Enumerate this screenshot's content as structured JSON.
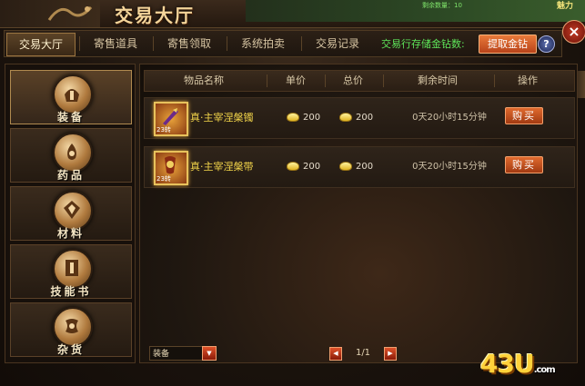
{
  "window": {
    "title": "交易大厅",
    "close_label": "×"
  },
  "game_overlay": {
    "line1": "剩余数量：10",
    "right_text": "魅力"
  },
  "tabs": [
    {
      "label": "交易大厅",
      "active": true
    },
    {
      "label": "寄售道具",
      "active": false
    },
    {
      "label": "寄售领取",
      "active": false
    },
    {
      "label": "系统拍卖",
      "active": false
    },
    {
      "label": "交易记录",
      "active": false
    }
  ],
  "storage": {
    "label": "交易行存储金钻数:",
    "withdraw_label": "提取金钻",
    "help_label": "?"
  },
  "categories": [
    {
      "label": "装备",
      "icon": "helmet-icon",
      "active": true
    },
    {
      "label": "药品",
      "icon": "potion-icon",
      "active": false
    },
    {
      "label": "材料",
      "icon": "gem-icon",
      "active": false
    },
    {
      "label": "技能书",
      "icon": "book-icon",
      "active": false
    },
    {
      "label": "杂货",
      "icon": "scroll-icon",
      "active": false
    }
  ],
  "table": {
    "headers": [
      "物品名称",
      "单价",
      "总价",
      "剩余时间",
      "操作"
    ],
    "rows": [
      {
        "name": "真·主宰涅槃镯",
        "badge": "23转",
        "unit_price": "200",
        "total_price": "200",
        "remaining": "0天20小时15分钟",
        "action": "购买"
      },
      {
        "name": "真·主宰涅槃带",
        "badge": "23转",
        "unit_price": "200",
        "total_price": "200",
        "remaining": "0天20小时15分钟",
        "action": "购买"
      }
    ]
  },
  "footer": {
    "filter_value": "装备",
    "page": "1/1",
    "prev": "◀",
    "next": "▶",
    "dropdown": "▼"
  },
  "watermark": {
    "text": "43U",
    "suffix": ".com"
  },
  "colors": {
    "accent": "#e06a2e",
    "gold_text": "#f4d64a",
    "green_text": "#5ee65a"
  }
}
